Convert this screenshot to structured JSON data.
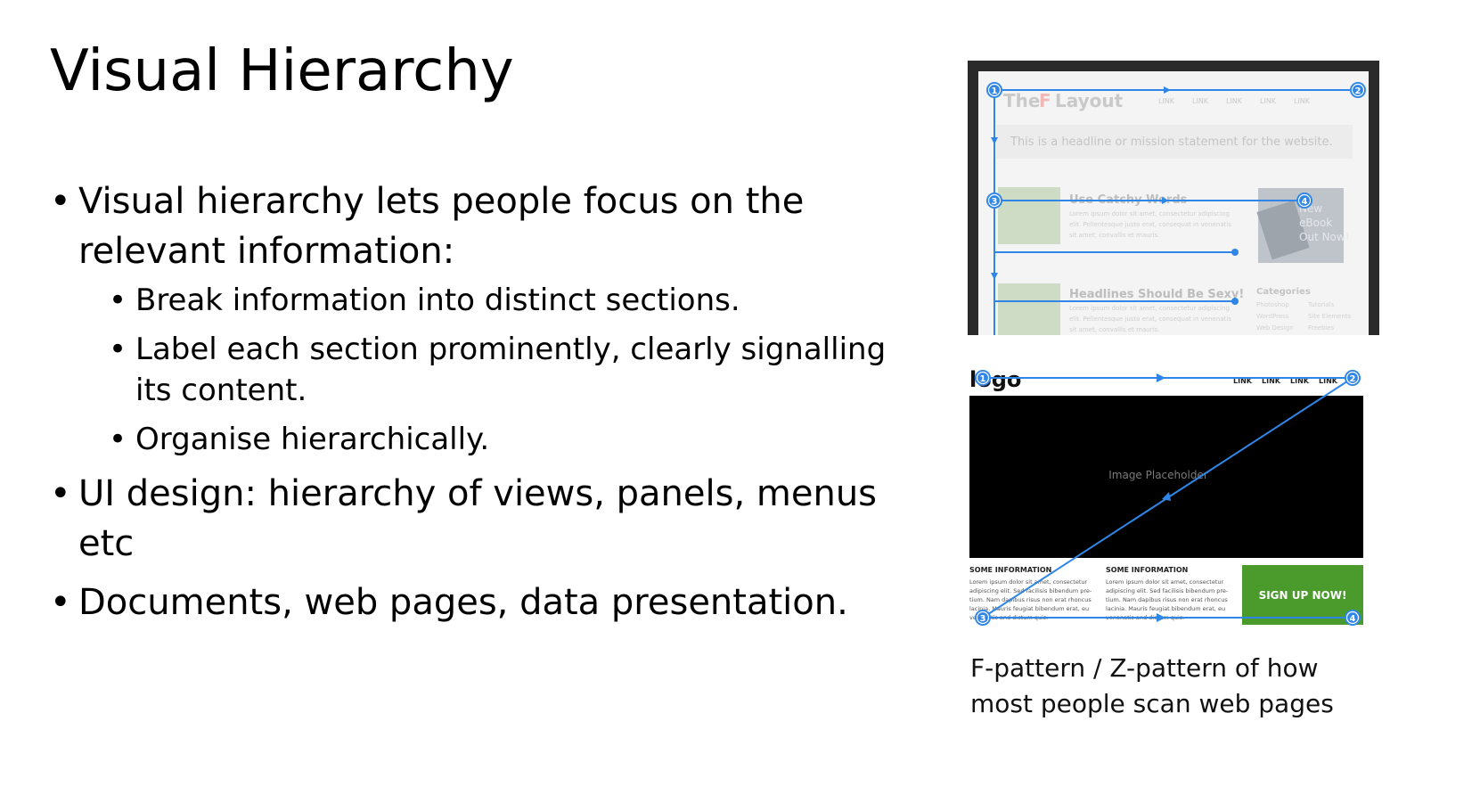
{
  "slide": {
    "title": "Visual Hierarchy",
    "bullets": [
      {
        "text": "Visual hierarchy lets people focus on the relevant information:",
        "sub": [
          "Break information into distinct sections.",
          "Label each section prominently, clearly signalling its content.",
          "Organise hierarchically."
        ]
      },
      {
        "text": "UI design: hierarchy of views, panels, menus etc"
      },
      {
        "text": "Documents, web pages, data presentation."
      }
    ]
  },
  "figures": {
    "f_pattern": {
      "heading_prefix": "The",
      "heading_letter": "F",
      "heading_suffix": "Layout",
      "nav_label": "LINK",
      "mission": "This is a headline or mission statement for the website.",
      "article1_title": "Use Catchy Words",
      "article2_title": "Headlines Should Be Sexy!",
      "lorem_line1": "Lorem ipsum dolor sit amet, consectetur adipiscing",
      "lorem_line2": "elit. Pellentesque justo erat, consequat in venenatis",
      "lorem_line3": "sit amet, convallis et mauris.",
      "ebook_line1": "New",
      "ebook_line2": "eBook",
      "ebook_line3": "Out Now!",
      "categories_title": "Categories",
      "categories": [
        "Photoshop",
        "Tutorials",
        "WordPress",
        "Site Elements",
        "Web Design",
        "Freebies"
      ],
      "markers": [
        "1",
        "2",
        "3",
        "4"
      ]
    },
    "z_pattern": {
      "logo": "logo",
      "nav": [
        "LINK",
        "LINK",
        "LINK",
        "LINK"
      ],
      "hero_text": "Image Placeholder",
      "col1_title": "SOME INFORMATION",
      "col2_title": "SOME INFORMATION",
      "body_lines": [
        "Lorem ipsum dolor sit amet, consectetur",
        "adipiscing elit. Sed facilisis bibendum pre-",
        "tium. Nam dapibus risus non erat rhoncus",
        "lacinia. Mauris feugiat bibendum erat, eu"
      ],
      "col1_last": "venenatis and dictum quis.",
      "col2_last": "venenatis and dictum quis.",
      "cta": "SIGN UP NOW!",
      "markers": [
        "1",
        "2",
        "3",
        "4"
      ]
    },
    "caption": "F-pattern / Z-pattern of how most people scan web pages"
  },
  "colors": {
    "accent_blue": "#2f86e6",
    "cta_green": "#4a9a2c",
    "frame_dark": "#2a2a2a"
  }
}
